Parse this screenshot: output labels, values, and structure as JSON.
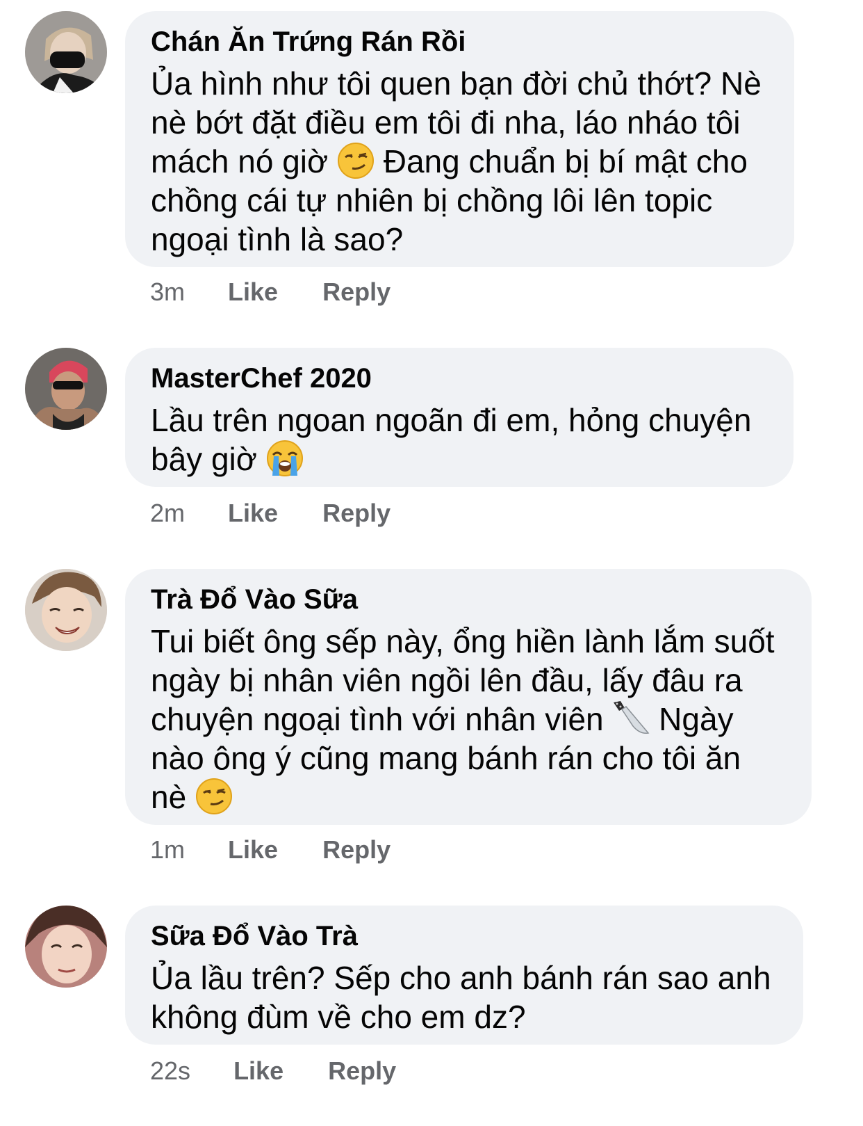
{
  "comments": [
    {
      "author": "Chán Ăn Trứng Rán Rồi",
      "text_before_emoji": "Ủa hình như tôi quen bạn đời chủ thớt? Nè\nnè bớt đặt điều em tôi đi nha, láo nháo tôi\nmách nó giờ ",
      "emoji": "smirking-face-icon",
      "text_after_emoji": " Đang chuẩn bị bí mật cho\nchồng cái tự nhiên bị chồng lôi lên topic\nngoại tình là sao?",
      "time": "3m",
      "like_label": "Like",
      "reply_label": "Reply"
    },
    {
      "author": "MasterChef 2020",
      "text_before_emoji": "Lầu trên ngoan ngoãn đi em, hỏng chuyện\nbây giờ ",
      "emoji": "loudly-crying-face-icon",
      "text_after_emoji": "",
      "time": "2m",
      "like_label": "Like",
      "reply_label": "Reply"
    },
    {
      "author": "Trà Đổ Vào Sữa",
      "text_before_emoji": "Tui biết ông sếp này, ổng hiền lành lắm suốt\nngày bị nhân viên ngồi lên đầu, lấy đâu ra\nchuyện ngoại tình với nhân viên ",
      "emoji": "kitchen-knife-icon",
      "text_after_emoji": " Ngày\nnào ông ý cũng mang bánh rán cho tôi ăn\nnè ",
      "emoji_2": "smirking-face-icon",
      "time": "1m",
      "like_label": "Like",
      "reply_label": "Reply"
    },
    {
      "author": "Sữa Đổ Vào Trà",
      "text_before_emoji": "Ủa lầu trên? Sếp cho anh bánh rán sao anh\nkhông đùm về cho em dz?",
      "time": "22s",
      "like_label": "Like",
      "reply_label": "Reply"
    }
  ],
  "colors": {
    "bubble_bg": "#f0f2f5",
    "meta_text": "#65676b",
    "body_text": "#050505"
  }
}
